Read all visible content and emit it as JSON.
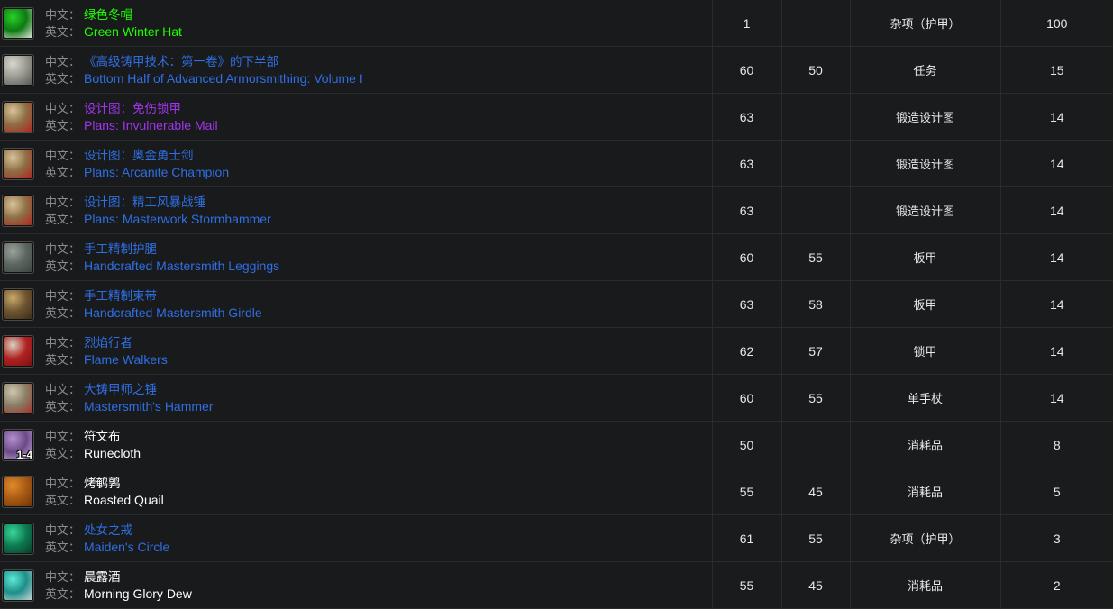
{
  "table": {
    "lang_labels": {
      "cn": "中文：",
      "en": "英文："
    },
    "quality_colors": {
      "uncommon": "#1eff00",
      "rare": "#2f6fe4",
      "epic": "#a335ee",
      "common": "#ffffff"
    },
    "rows": [
      {
        "icon": "green-winter-hat-icon",
        "icon_colors": {
          "a": "#2ad02a",
          "b": "#0d7a12",
          "c": "#e8e8e0"
        },
        "stack": "",
        "name_cn": "绿色冬帽",
        "name_en": "Green Winter Hat",
        "quality": "uncommon",
        "level": "1",
        "req_level": "",
        "type": "杂项（护甲）",
        "chance": "100"
      },
      {
        "icon": "book-page-icon",
        "icon_colors": {
          "a": "#d8d8d0",
          "b": "#9a9a90",
          "c": "#555"
        },
        "stack": "",
        "name_cn": "《高级铸甲技术：第一卷》的下半部",
        "name_en": "Bottom Half of Advanced Armorsmithing: Volume I",
        "quality": "rare",
        "level": "60",
        "req_level": "50",
        "type": "任务",
        "chance": "15"
      },
      {
        "icon": "scroll-plans-icon",
        "icon_colors": {
          "a": "#d9c39a",
          "b": "#8d6f44",
          "c": "#b22222"
        },
        "stack": "",
        "name_cn": "设计图：免伤锁甲",
        "name_en": "Plans: Invulnerable Mail",
        "quality": "epic",
        "level": "63",
        "req_level": "",
        "type": "锻造设计图",
        "chance": "14"
      },
      {
        "icon": "scroll-plans-icon",
        "icon_colors": {
          "a": "#d9c39a",
          "b": "#8d6f44",
          "c": "#b22222"
        },
        "stack": "",
        "name_cn": "设计图：奥金勇士剑",
        "name_en": "Plans: Arcanite Champion",
        "quality": "rare",
        "level": "63",
        "req_level": "",
        "type": "锻造设计图",
        "chance": "14"
      },
      {
        "icon": "scroll-plans-icon",
        "icon_colors": {
          "a": "#d9c39a",
          "b": "#8d6f44",
          "c": "#b22222"
        },
        "stack": "",
        "name_cn": "设计图：精工风暴战锤",
        "name_en": "Plans: Masterwork Stormhammer",
        "quality": "rare",
        "level": "63",
        "req_level": "",
        "type": "锻造设计图",
        "chance": "14"
      },
      {
        "icon": "plate-leggings-icon",
        "icon_colors": {
          "a": "#9aa39a",
          "b": "#5c6660",
          "c": "#3b4440"
        },
        "stack": "",
        "name_cn": "手工精制护腿",
        "name_en": "Handcrafted Mastersmith Leggings",
        "quality": "rare",
        "level": "60",
        "req_level": "55",
        "type": "板甲",
        "chance": "14"
      },
      {
        "icon": "plate-girdle-icon",
        "icon_colors": {
          "a": "#c9a96a",
          "b": "#6d5430",
          "c": "#3a2c18"
        },
        "stack": "",
        "name_cn": "手工精制束带",
        "name_en": "Handcrafted Mastersmith Girdle",
        "quality": "rare",
        "level": "63",
        "req_level": "58",
        "type": "板甲",
        "chance": "14"
      },
      {
        "icon": "flame-boots-icon",
        "icon_colors": {
          "a": "#d8d2c0",
          "b": "#b22222",
          "c": "#7a1010"
        },
        "stack": "",
        "name_cn": "烈焰行者",
        "name_en": "Flame Walkers",
        "quality": "rare",
        "level": "62",
        "req_level": "57",
        "type": "锁甲",
        "chance": "14"
      },
      {
        "icon": "hammer-icon",
        "icon_colors": {
          "a": "#cfc6b0",
          "b": "#8a7f66",
          "c": "#a23030"
        },
        "stack": "",
        "name_cn": "大铸甲师之锤",
        "name_en": "Mastersmith's Hammer",
        "quality": "rare",
        "level": "60",
        "req_level": "55",
        "type": "单手杖",
        "chance": "14"
      },
      {
        "icon": "runecloth-icon",
        "icon_colors": {
          "a": "#b58fd0",
          "b": "#6a4a86",
          "c": "#d8b0e8"
        },
        "stack": "1-4",
        "name_cn": "符文布",
        "name_en": "Runecloth",
        "quality": "common",
        "level": "50",
        "req_level": "",
        "type": "消耗品",
        "chance": "8"
      },
      {
        "icon": "roasted-quail-icon",
        "icon_colors": {
          "a": "#e08a2a",
          "b": "#a85a14",
          "c": "#6b3408"
        },
        "stack": "",
        "name_cn": "烤鹌鹑",
        "name_en": "Roasted Quail",
        "quality": "common",
        "level": "55",
        "req_level": "45",
        "type": "消耗品",
        "chance": "5"
      },
      {
        "icon": "ring-icon",
        "icon_colors": {
          "a": "#3ad89a",
          "b": "#0e7a52",
          "c": "#0a3a28"
        },
        "stack": "",
        "name_cn": "处女之戒",
        "name_en": "Maiden's Circle",
        "quality": "rare",
        "level": "61",
        "req_level": "55",
        "type": "杂项（护甲）",
        "chance": "3"
      },
      {
        "icon": "drink-bowl-icon",
        "icon_colors": {
          "a": "#5fe8d8",
          "b": "#1d8f88",
          "c": "#cfd6da"
        },
        "stack": "",
        "name_cn": "晨露酒",
        "name_en": "Morning Glory Dew",
        "quality": "common",
        "level": "55",
        "req_level": "45",
        "type": "消耗品",
        "chance": "2"
      }
    ]
  }
}
